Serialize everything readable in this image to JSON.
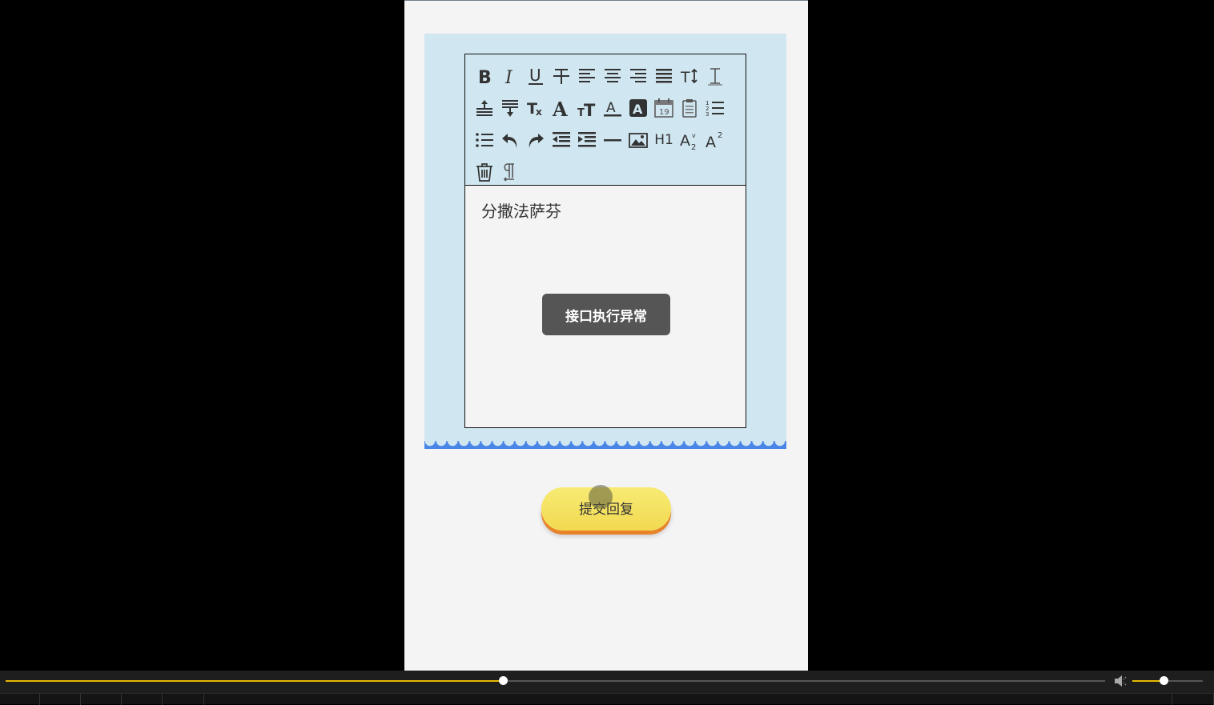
{
  "editor": {
    "content_text": "分撒法萨芬",
    "toolbar_icons": [
      "bold-icon",
      "italic-icon",
      "underline-icon",
      "strikethrough-icon",
      "align-left-icon",
      "align-center-icon",
      "align-right-icon",
      "align-justify-icon",
      "font-size-icon",
      "line-height-icon",
      "paragraph-before-icon",
      "paragraph-after-icon",
      "clear-format-icon",
      "font-family-icon",
      "font-size-scale-icon",
      "font-color-icon",
      "background-color-icon",
      "date-icon",
      "clipboard-icon",
      "ordered-list-icon",
      "unordered-list-icon",
      "undo-icon",
      "redo-icon",
      "outdent-icon",
      "indent-icon",
      "horizontal-rule-icon",
      "image-icon",
      "heading-icon",
      "subscript-icon",
      "superscript-icon",
      "trash-icon",
      "paragraph-mark-icon"
    ],
    "heading_label": "H1"
  },
  "toast": {
    "message": "接口执行异常"
  },
  "submit": {
    "label": "提交回复"
  },
  "player": {
    "progress": 0.452,
    "volume": 0.44,
    "accent_color": "#e6b800"
  },
  "colors": {
    "panel_bg": "#d0e6f0",
    "scallop": "#4a86e8",
    "button_yellow": "#f2d950",
    "button_shadow": "#e8832a",
    "toast_bg": "#555555"
  }
}
